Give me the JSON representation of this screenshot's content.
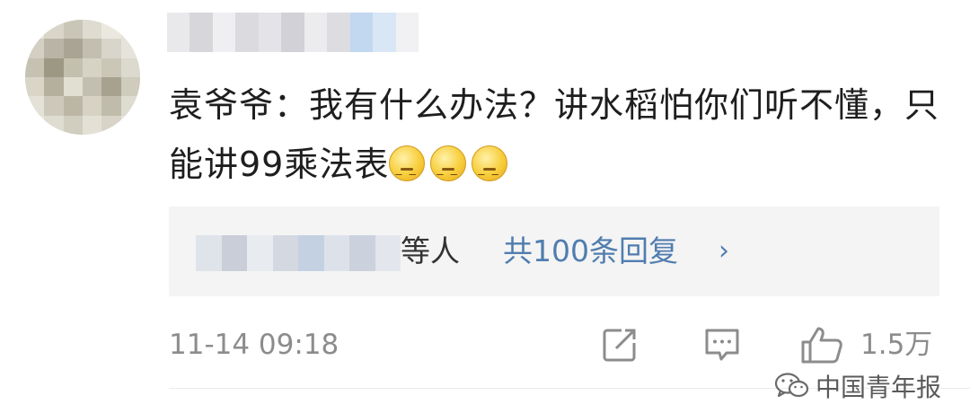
{
  "post": {
    "comment_text": "袁爷爷：我有什么办法？讲水稻怕你们听不懂，只能讲99乘法表",
    "emoji_count": 3,
    "emoji_name": "dizzy-face-emoji"
  },
  "replies": {
    "suffix": "等人",
    "total": "共100条回复",
    "chevron": "›"
  },
  "footer": {
    "timestamp": "11-14 09:18",
    "like_count": "1.5万",
    "icons": [
      "share-icon",
      "comment-icon",
      "like-icon"
    ]
  },
  "watermark": {
    "text": "中国青年报",
    "icon": "wechat-icon"
  },
  "colors": {
    "link": "#507daf",
    "meta": "#8c8c8c",
    "reply_bg": "#f4f4f4",
    "text": "#1e1e1e"
  }
}
